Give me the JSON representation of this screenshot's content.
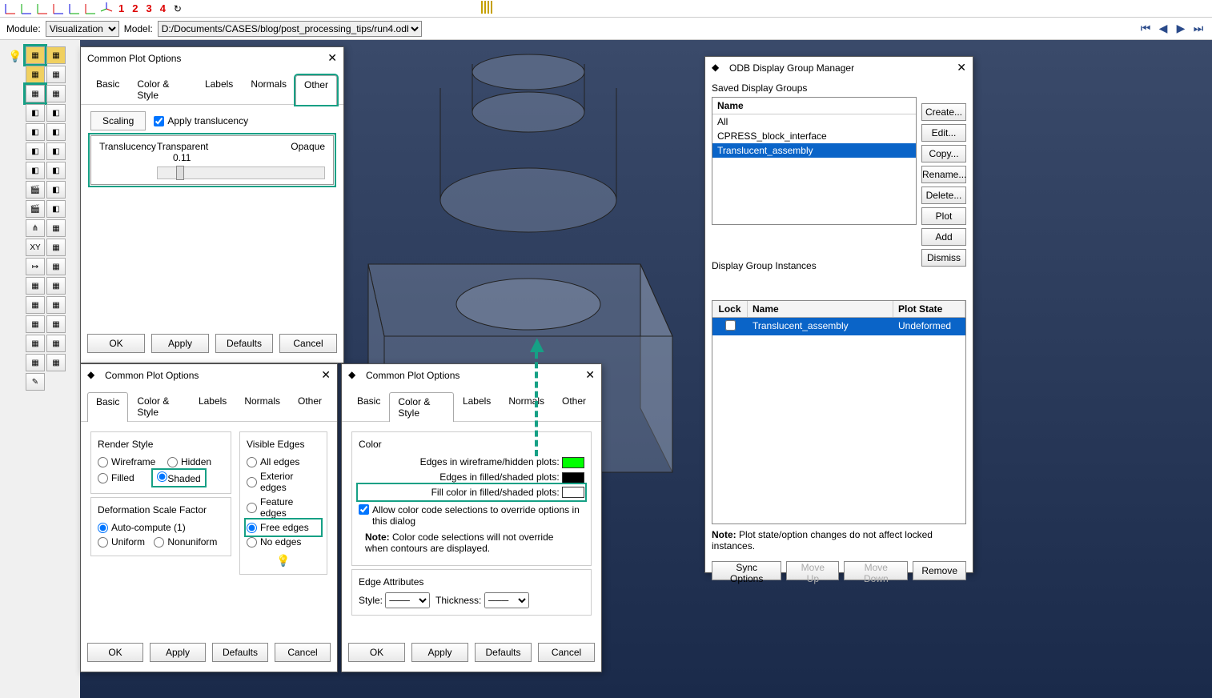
{
  "toolbar": {
    "numbers": [
      "1",
      "2",
      "3",
      "4"
    ]
  },
  "module": {
    "label": "Module:",
    "value": "Visualization",
    "model_label": "Model:",
    "model_value": "D:/Documents/CASES/blog/post_processing_tips/run4.odb"
  },
  "dialog1": {
    "title": "Common Plot Options",
    "tabs": [
      "Basic",
      "Color & Style",
      "Labels",
      "Normals",
      "Other"
    ],
    "active_tab": "Other",
    "subtabs": [
      "Scaling",
      "Translucency"
    ],
    "apply_trans": "Apply translucency",
    "trans_label": "Translucency",
    "transparent": "Transparent",
    "opaque": "Opaque",
    "value": "0.11",
    "buttons": [
      "OK",
      "Apply",
      "Defaults",
      "Cancel"
    ]
  },
  "dialog2": {
    "title": "Common Plot Options",
    "tabs": [
      "Basic",
      "Color & Style",
      "Labels",
      "Normals",
      "Other"
    ],
    "active_tab": "Basic",
    "render_style": "Render Style",
    "wireframe": "Wireframe",
    "hidden": "Hidden",
    "filled": "Filled",
    "shaded": "Shaded",
    "deform": "Deformation Scale Factor",
    "auto": "Auto-compute  (1)",
    "uniform": "Uniform",
    "nonuniform": "Nonuniform",
    "visible": "Visible Edges",
    "all": "All edges",
    "exterior": "Exterior edges",
    "feature": "Feature edges",
    "free": "Free edges",
    "noedges": "No edges",
    "buttons": [
      "OK",
      "Apply",
      "Defaults",
      "Cancel"
    ]
  },
  "dialog3": {
    "title": "Common Plot Options",
    "tabs": [
      "Basic",
      "Color & Style",
      "Labels",
      "Normals",
      "Other"
    ],
    "active_tab": "Color & Style",
    "color": "Color",
    "wire_edges": "Edges in wireframe/hidden plots:",
    "fill_edges": "Edges in filled/shaded plots:",
    "fill_color": "Fill color in filled/shaded plots:",
    "allow": "Allow color code selections to override options in this dialog",
    "note_lbl": "Note:",
    "note_txt": "Color code selections will not override when contours are displayed.",
    "edge_attr": "Edge Attributes",
    "style": "Style:",
    "thickness": "Thickness:",
    "buttons": [
      "OK",
      "Apply",
      "Defaults",
      "Cancel"
    ]
  },
  "odb": {
    "title": "ODB Display Group Manager",
    "saved": "Saved Display Groups",
    "name": "Name",
    "groups": [
      "All",
      "CPRESS_block_interface",
      "Translucent_assembly"
    ],
    "selected_group": "Translucent_assembly",
    "side_buttons": [
      "Create...",
      "Edit...",
      "Copy...",
      "Rename...",
      "Delete...",
      "Plot",
      "Add",
      "Dismiss"
    ],
    "instances": "Display Group Instances",
    "cols": [
      "Lock",
      "Name",
      "Plot State"
    ],
    "inst_name": "Translucent_assembly",
    "inst_state": "Undeformed",
    "note_lbl": "Note:",
    "note_txt": "Plot state/option changes do not affect locked instances.",
    "bottom": [
      "Sync Options",
      "Move Up",
      "Move Down",
      "Remove"
    ]
  }
}
